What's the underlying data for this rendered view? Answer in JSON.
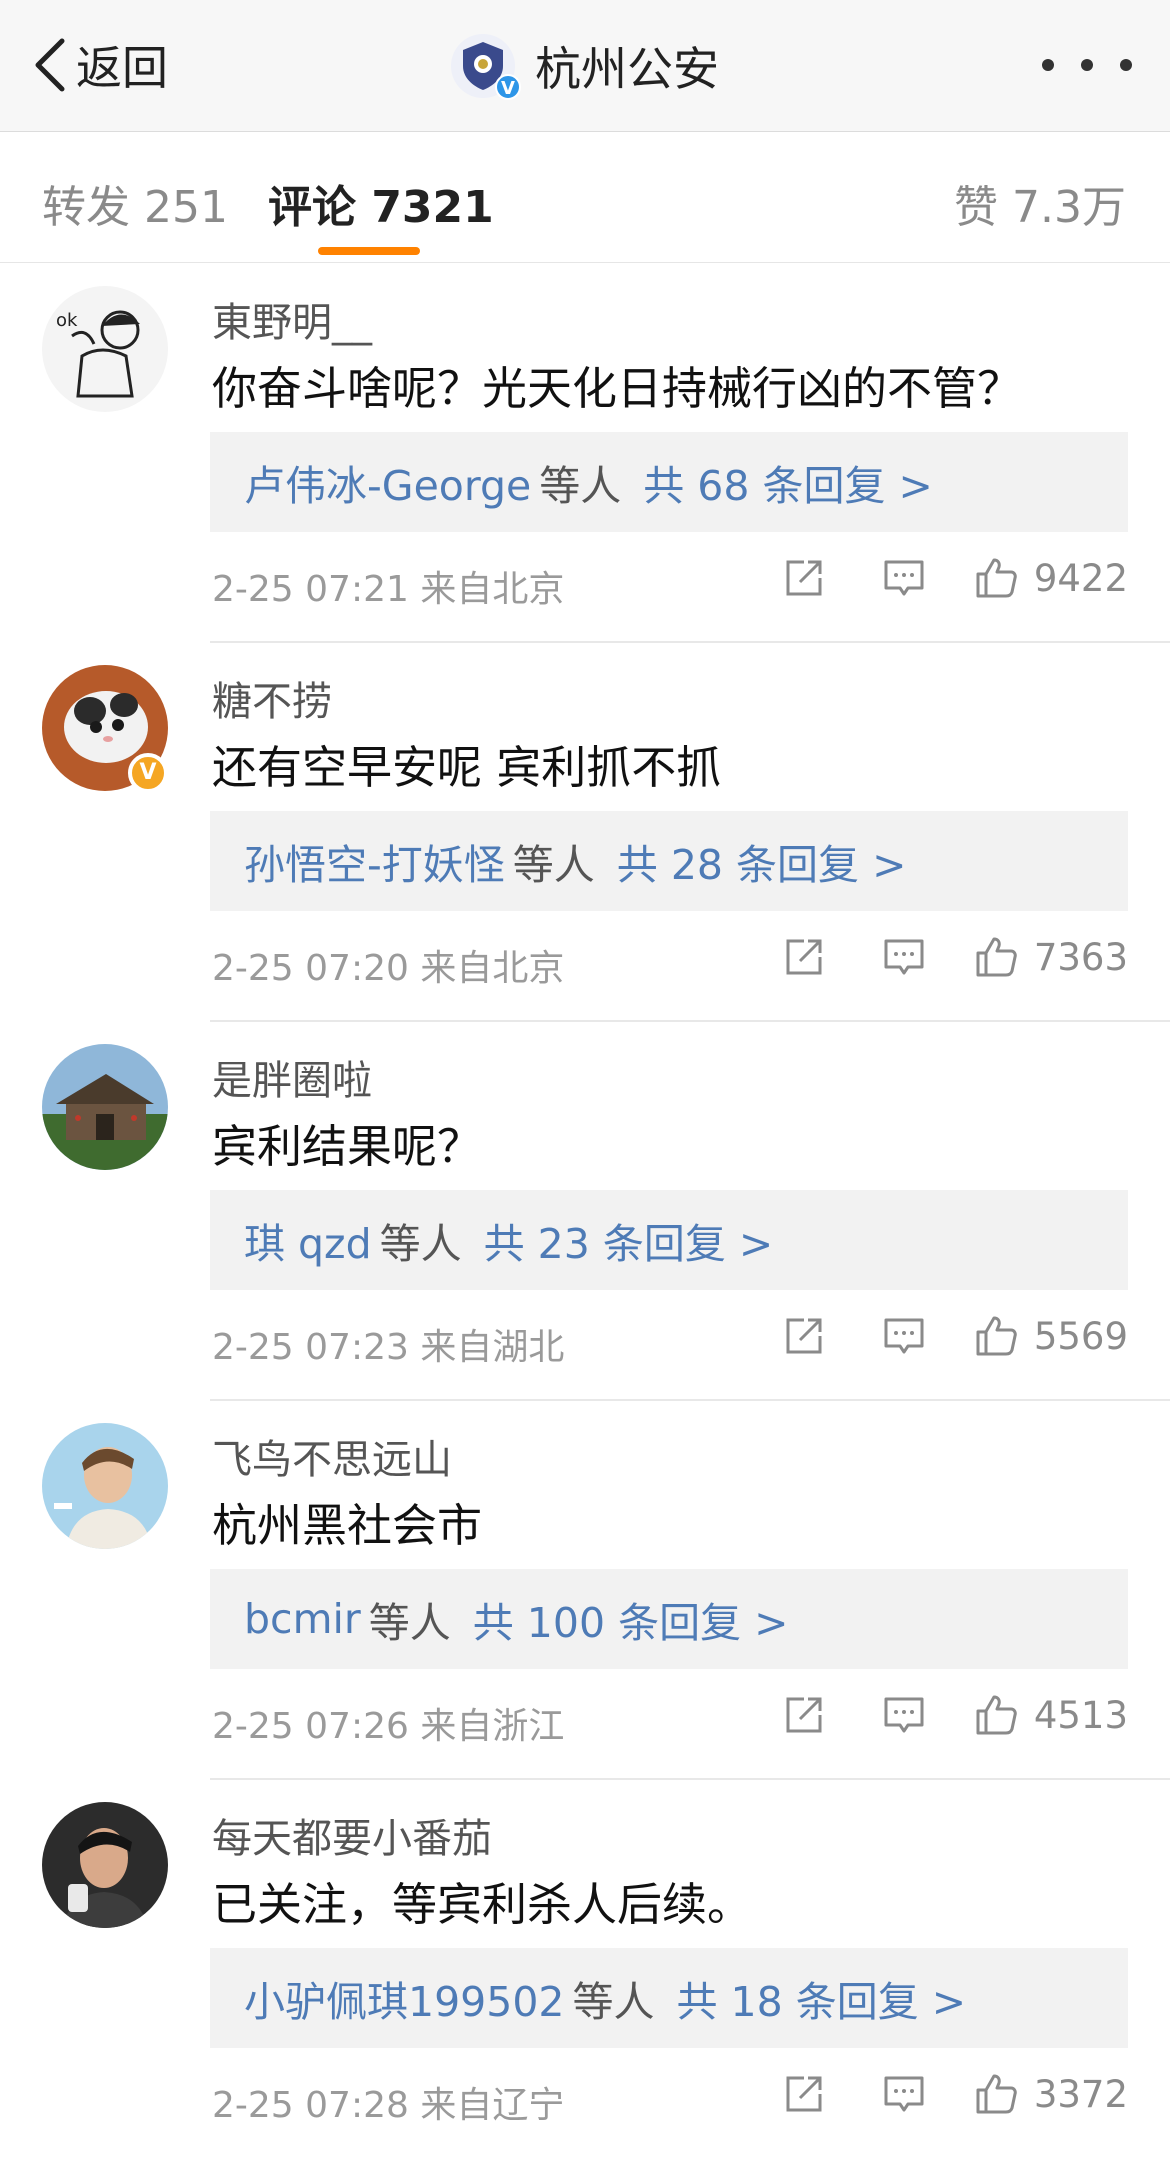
{
  "nav": {
    "back_label": "返回",
    "title": "杭州公安",
    "account_badge": "V",
    "more_icon": "more-dots-icon",
    "back_icon": "chevron-left-icon"
  },
  "tabs": {
    "repost": "转发 251",
    "comments": "评论 7321",
    "likes": "赞 7.3万",
    "active": "comments",
    "accent_color": "#ff8200"
  },
  "comments": [
    {
      "username": "東野明__",
      "text": "你奋斗啥呢？光天化日持械行凶的不管？",
      "reply_names": "卢伟冰-George",
      "reply_mid": "等人",
      "reply_count": "共 68 条回复 >",
      "time": "2-25 07:21",
      "source": "来自北京",
      "likes": "9422",
      "verified": false
    },
    {
      "username": "糖不捞",
      "text": "还有空早安呢 宾利抓不抓",
      "reply_names": "孙悟空-打妖怪",
      "reply_mid": "等人",
      "reply_count": "共 28 条回复 >",
      "time": "2-25 07:20",
      "source": "来自北京",
      "likes": "7363",
      "verified": true,
      "badge": "V"
    },
    {
      "username": "是胖圈啦",
      "text": "宾利结果呢？",
      "reply_names": "琪 qzd",
      "reply_mid": "等人",
      "reply_count": "共 23 条回复 >",
      "time": "2-25 07:23",
      "source": "来自湖北",
      "likes": "5569",
      "verified": false
    },
    {
      "username": "飞鸟不思远山",
      "text": "杭州黑社会市",
      "reply_names": "bcmir",
      "reply_mid": "等人",
      "reply_count": "共 100 条回复 >",
      "time": "2-25 07:26",
      "source": "来自浙江",
      "likes": "4513",
      "verified": false
    },
    {
      "username": "每天都要小番茄",
      "text": "已关注，等宾利杀人后续。",
      "reply_names": "小驴佩琪199502",
      "reply_mid": "等人",
      "reply_count": "共 18 条回复 >",
      "time": "2-25 07:28",
      "source": "来自辽宁",
      "likes": "3372",
      "verified": false
    }
  ],
  "colors": {
    "link": "#4e7bb6",
    "meta": "#9a9a9a",
    "reply_bg": "#f2f2f2",
    "verified_gold": "#f5a623",
    "verified_blue": "#2e96e8"
  }
}
